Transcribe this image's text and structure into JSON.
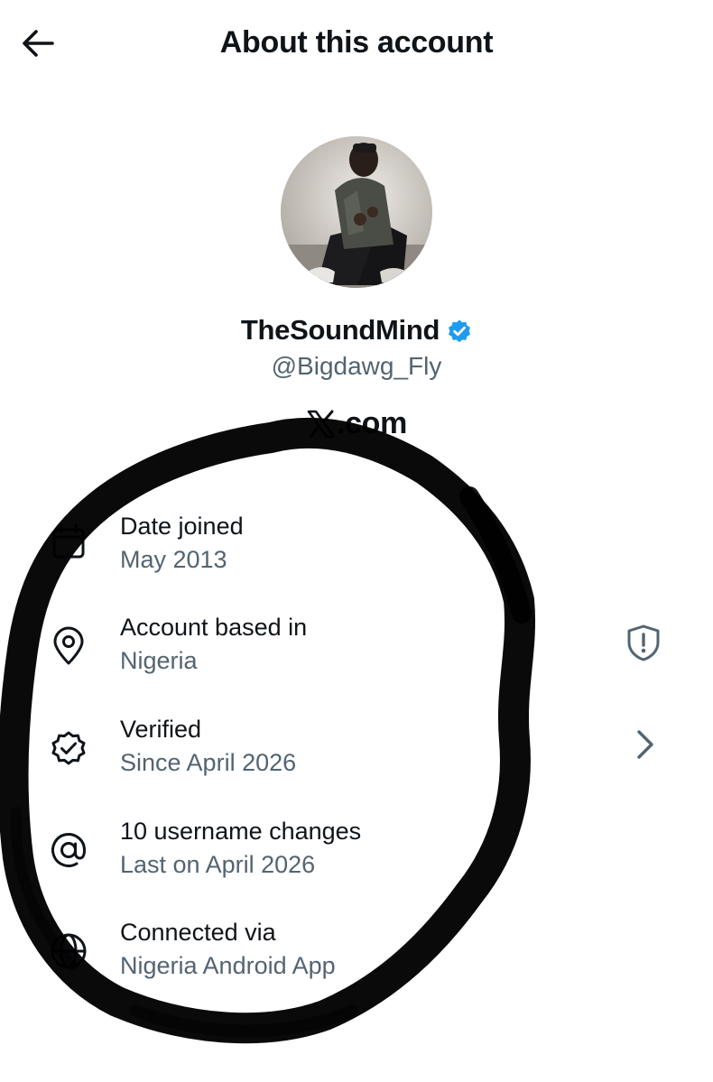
{
  "header": {
    "title": "About this account",
    "back_icon": "arrow-left-icon"
  },
  "profile": {
    "display_name": "TheSoundMind",
    "handle": "@Bigdawg_Fly",
    "verified_badge_color": "#1d9bf0",
    "brand_text": ".com",
    "brand_icon": "x-logo-icon"
  },
  "info": {
    "date_joined": {
      "title": "Date joined",
      "value": "May 2013",
      "icon": "calendar-icon"
    },
    "account_based": {
      "title": "Account based in",
      "value": "Nigeria",
      "icon": "location-pin-icon",
      "trailing_icon": "shield-alert-icon"
    },
    "verified": {
      "title": "Verified",
      "value": "Since April 2026",
      "icon": "verified-seal-icon",
      "trailing_icon": "chevron-right-icon"
    },
    "username_changes": {
      "title": "10 username changes",
      "value": "Last on April 2026",
      "icon": "at-sign-icon"
    },
    "connected_via": {
      "title": "Connected via",
      "value": "Nigeria Android App",
      "icon": "globe-icon"
    }
  },
  "colors": {
    "text_primary": "#0f1419",
    "text_secondary": "#536471",
    "accent": "#1d9bf0",
    "annotation_marker": "#000000"
  }
}
